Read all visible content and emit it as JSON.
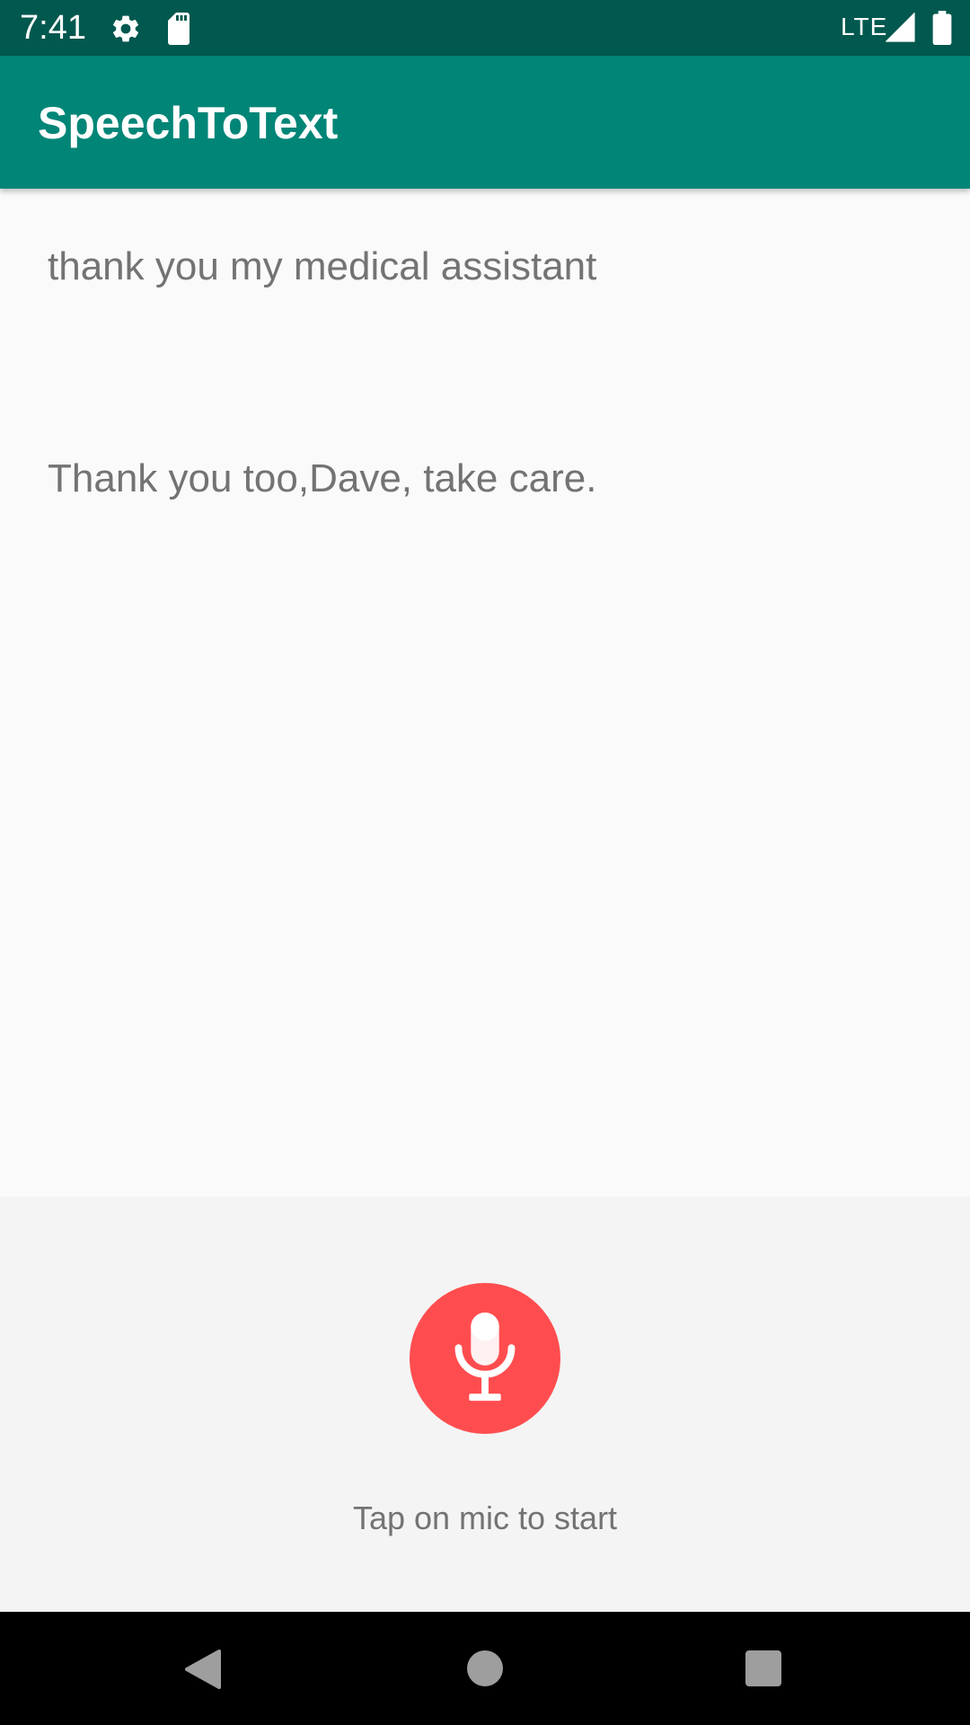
{
  "status_bar": {
    "time": "7:41",
    "network": "LTE",
    "icons": [
      "gear-icon",
      "sd-card-icon",
      "signal-icon",
      "battery-icon"
    ]
  },
  "app_bar": {
    "title": "SpeechToText",
    "color": "#008577"
  },
  "conversation": {
    "messages": [
      "thank you my medical assistant",
      "Thank you too,Dave, take care."
    ]
  },
  "voice_input": {
    "mic_icon": "microphone-icon",
    "mic_color": "#ff4d4f",
    "hint": "Tap on mic to start"
  },
  "nav_bar": {
    "icons": [
      "back-icon",
      "home-icon",
      "recents-icon"
    ]
  }
}
